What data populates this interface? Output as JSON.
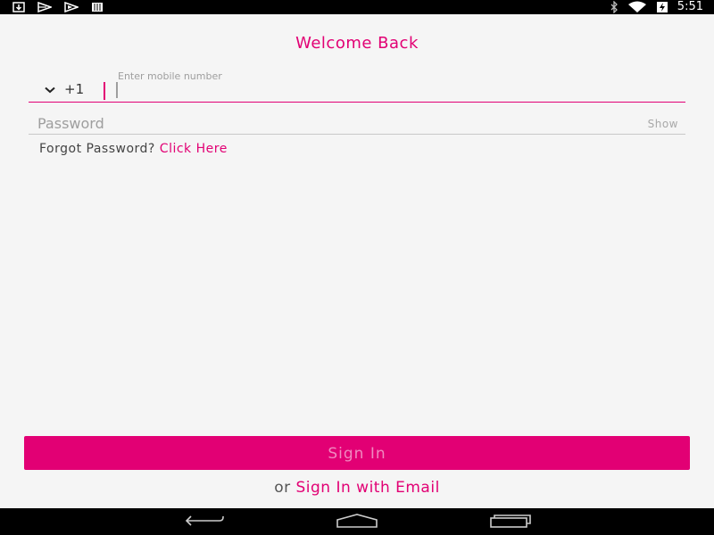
{
  "status_bar": {
    "time": "5:51",
    "left_icons": [
      "download-icon",
      "play-store-icon",
      "play-icon",
      "sim-icon"
    ],
    "right_icons": [
      "bluetooth-icon",
      "wifi-icon",
      "battery-charging-icon"
    ]
  },
  "login": {
    "title": "Welcome Back",
    "country_code": "+1",
    "phone_label": "Enter mobile number",
    "phone_value": "",
    "password_placeholder": "Password",
    "password_value": "",
    "show_label": "Show",
    "forgot_text": "Forgot Password?",
    "forgot_link": "Click Here",
    "signin_label": "Sign In",
    "alt_prefix": "or",
    "alt_link": "Sign In with Email"
  },
  "nav_bar": {
    "buttons": [
      "back-icon",
      "home-icon",
      "recents-icon"
    ]
  },
  "colors": {
    "accent": "#e20074",
    "background": "#f5f5f5"
  }
}
